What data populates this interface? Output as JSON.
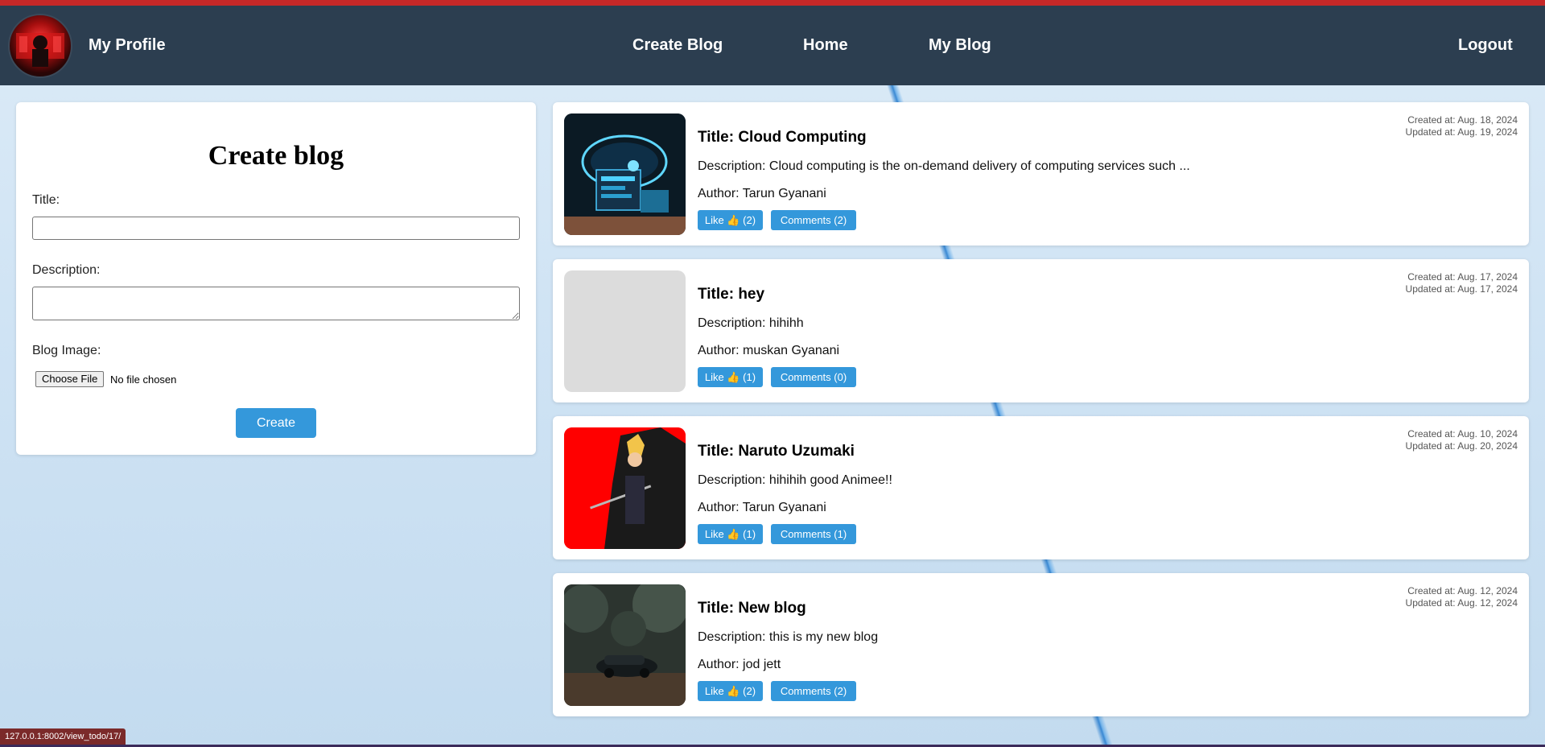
{
  "nav": {
    "profile_label": "My Profile",
    "create_blog_label": "Create Blog",
    "home_label": "Home",
    "my_blog_label": "My Blog",
    "logout_label": "Logout"
  },
  "form": {
    "heading": "Create blog",
    "title_label": "Title:",
    "title_value": "",
    "description_label": "Description:",
    "description_value": "",
    "image_label": "Blog Image:",
    "choose_file_label": "Choose File",
    "no_file_text": "No file chosen",
    "submit_label": "Create"
  },
  "posts": [
    {
      "title": "Title: Cloud Computing",
      "description": "Description: Cloud computing is the on-demand delivery of computing services such ...",
      "author": "Author: Tarun Gyanani",
      "like_label": "Like 👍 (2)",
      "comments_label": "Comments (2)",
      "created": "Created at: Aug. 18, 2024",
      "updated": "Updated at: Aug. 19, 2024",
      "image": "cloud-computing-image"
    },
    {
      "title": "Title: hey",
      "description": "Description: hihihh",
      "author": "Author: muskan Gyanani",
      "like_label": "Like 👍 (1)",
      "comments_label": "Comments (0)",
      "created": "Created at: Aug. 17, 2024",
      "updated": "Updated at: Aug. 17, 2024",
      "image": "placeholder-image"
    },
    {
      "title": "Title: Naruto Uzumaki",
      "description": "Description: hihihih good Animee!!",
      "author": "Author: Tarun Gyanani",
      "like_label": "Like 👍 (1)",
      "comments_label": "Comments (1)",
      "created": "Created at: Aug. 10, 2024",
      "updated": "Updated at: Aug. 20, 2024",
      "image": "anime-character-image"
    },
    {
      "title": "Title: New blog",
      "description": "Description: this is my new blog",
      "author": "Author: jod jett",
      "like_label": "Like 👍 (2)",
      "comments_label": "Comments (2)",
      "created": "Created at: Aug. 12, 2024",
      "updated": "Updated at: Aug. 12, 2024",
      "image": "car-photo-image"
    }
  ],
  "status_url": "127.0.0.1:8002/view_todo/17/",
  "colors": {
    "navbar": "#2c3e50",
    "accent": "#3498db",
    "top_border": "#c62828"
  }
}
